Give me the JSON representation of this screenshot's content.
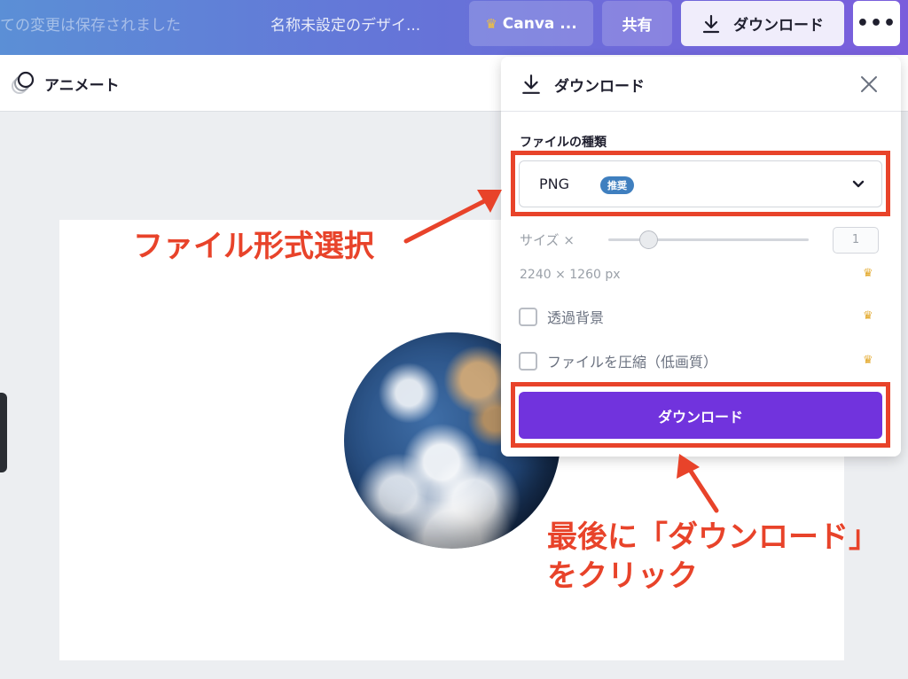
{
  "topbar": {
    "status_text": "ての変更は保存されました",
    "design_title": "名称未設定のデザイ...",
    "canva_button": "Canva ...",
    "share_button": "共有",
    "download_button": "ダウンロード",
    "more_button": "•••"
  },
  "toolbar": {
    "animate_label": "アニメート"
  },
  "download_panel": {
    "title": "ダウンロード",
    "file_type_label": "ファイルの種類",
    "file_type_value": "PNG",
    "file_type_badge": "推奨",
    "size_label": "サイズ ×",
    "size_value": "1",
    "size_slider_fraction": 0.2,
    "dimensions": "2240 × 1260 px",
    "transparent_bg_label": "透過背景",
    "compress_label": "ファイルを圧縮（低画質）",
    "download_button": "ダウンロード",
    "pro_icon": "crown-icon"
  },
  "annotations": {
    "file_format": "ファイル形式選択",
    "final_line1": "最後に「ダウンロード」",
    "final_line2": "をクリック"
  },
  "colors": {
    "accent_purple": "#7133dd",
    "annotation_red": "#e8432a",
    "badge_blue": "#3f7fbf",
    "crown_gold": "#e3a82a"
  }
}
